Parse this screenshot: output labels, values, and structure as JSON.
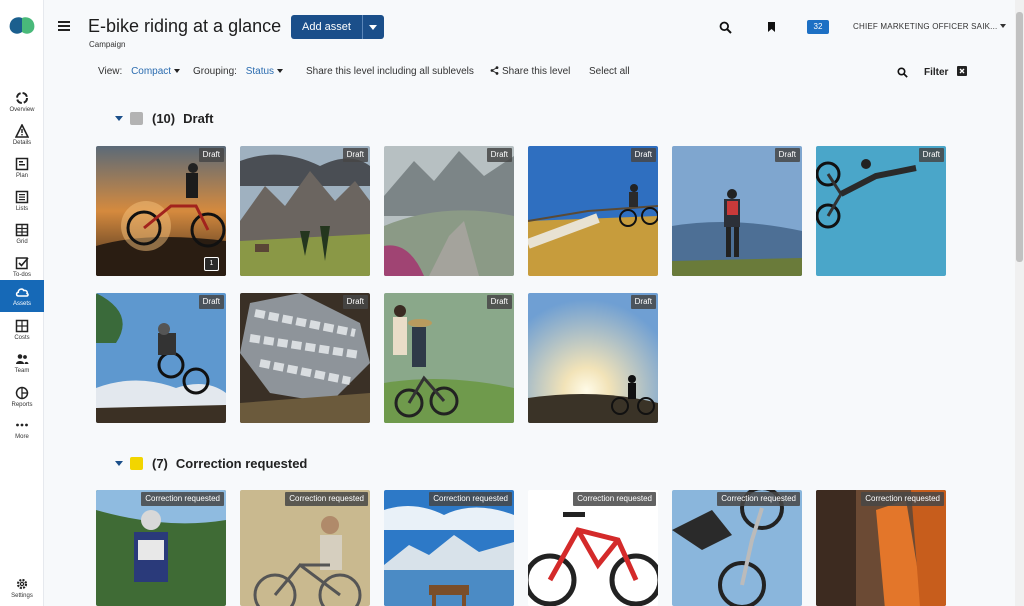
{
  "sidebar": {
    "items": [
      {
        "label": "Overview",
        "icon": "overview-icon"
      },
      {
        "label": "Details",
        "icon": "warning-icon"
      },
      {
        "label": "Plan",
        "icon": "plan-icon"
      },
      {
        "label": "Lists",
        "icon": "list-icon"
      },
      {
        "label": "Grid",
        "icon": "grid-icon"
      },
      {
        "label": "To-dos",
        "icon": "checkbox-icon"
      },
      {
        "label": "Assets",
        "icon": "cloud-icon"
      },
      {
        "label": "Costs",
        "icon": "costs-icon"
      },
      {
        "label": "Team",
        "icon": "team-icon"
      },
      {
        "label": "Reports",
        "icon": "reports-icon"
      },
      {
        "label": "More",
        "icon": "more-icon"
      }
    ],
    "settings_label": "Settings",
    "active": "Assets",
    "active_color": "#1669b7"
  },
  "header": {
    "title": "E-bike riding at a glance",
    "subtitle": "Campaign",
    "add_asset_label": "Add asset",
    "badge_count": "32",
    "user_label": "CHIEF MARKETING OFFICER SAIK..."
  },
  "toolbar": {
    "view_label": "View:",
    "view_value": "Compact",
    "grouping_label": "Grouping:",
    "grouping_value": "Status",
    "share_all": "Share this level including all sublevels",
    "share_level": "Share this level",
    "select_all": "Select all",
    "filter_label": "Filter"
  },
  "groups": [
    {
      "count": "(10)",
      "name": "Draft",
      "swatch": "#b3b3b3",
      "tiles": [
        {
          "status": "Draft",
          "comments": "1"
        },
        {
          "status": "Draft"
        },
        {
          "status": "Draft"
        },
        {
          "status": "Draft"
        },
        {
          "status": "Draft"
        },
        {
          "status": "Draft"
        },
        {
          "status": "Draft"
        },
        {
          "status": "Draft"
        },
        {
          "status": "Draft"
        },
        {
          "status": "Draft"
        }
      ]
    },
    {
      "count": "(7)",
      "name": "Correction requested",
      "swatch": "#f2d500",
      "tiles": [
        {
          "status": "Correction requested"
        },
        {
          "status": "Correction requested"
        },
        {
          "status": "Correction requested"
        },
        {
          "status": "Correction requested"
        },
        {
          "status": "Correction requested"
        },
        {
          "status": "Correction requested"
        }
      ]
    }
  ],
  "colors": {
    "accent": "#1b4f8a",
    "link": "#2b6cb0"
  }
}
